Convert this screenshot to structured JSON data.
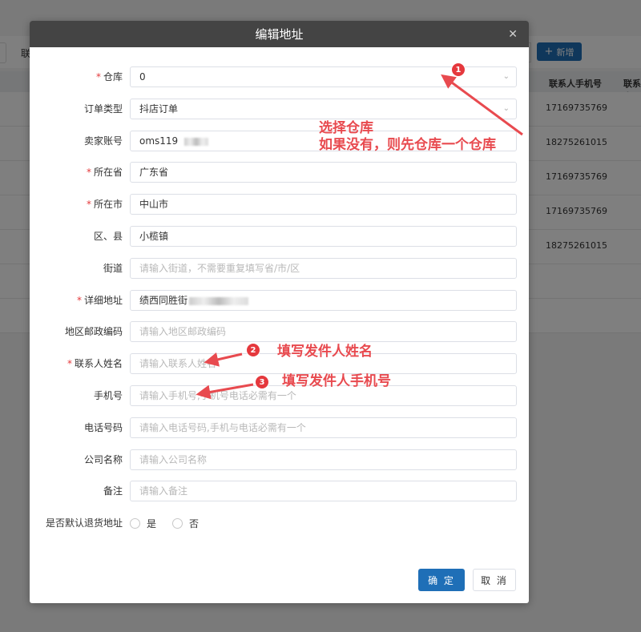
{
  "background": {
    "left_label": "联",
    "add_button": {
      "icon": "plus-icon",
      "label": "新增"
    },
    "table_headers": [
      "联系人手机号",
      "联系人"
    ],
    "rows": [
      "17169735769",
      "18275261015",
      "17169735769",
      "17169735769",
      "18275261015"
    ]
  },
  "modal": {
    "title": "编辑地址",
    "close_icon": "close-icon",
    "fields": [
      {
        "label": "仓库",
        "required": true,
        "value": "0",
        "placeholder": "",
        "type": "select"
      },
      {
        "label": "订单类型",
        "required": false,
        "value": "抖店订单",
        "placeholder": "",
        "type": "select"
      },
      {
        "label": "卖家账号",
        "required": false,
        "value": "oms119",
        "placeholder": "",
        "type": "text"
      },
      {
        "label": "所在省",
        "required": true,
        "value": "广东省",
        "placeholder": "",
        "type": "text"
      },
      {
        "label": "所在市",
        "required": true,
        "value": "中山市",
        "placeholder": "",
        "type": "text"
      },
      {
        "label": "区、县",
        "required": false,
        "value": "小榄镇",
        "placeholder": "",
        "type": "text"
      },
      {
        "label": "街道",
        "required": false,
        "value": "",
        "placeholder": "请输入街道，不需要重复填写省/市/区",
        "type": "text"
      },
      {
        "label": "详细地址",
        "required": true,
        "value": "绩西同胜街",
        "placeholder": "",
        "type": "text"
      },
      {
        "label": "地区邮政编码",
        "required": false,
        "value": "",
        "placeholder": "请输入地区邮政编码",
        "type": "text"
      },
      {
        "label": "联系人姓名",
        "required": true,
        "value": "",
        "placeholder": "请输入联系人姓名",
        "type": "text"
      },
      {
        "label": "手机号",
        "required": false,
        "value": "",
        "placeholder": "请输入手机号,手机号电话必需有一个",
        "type": "text"
      },
      {
        "label": "电话号码",
        "required": false,
        "value": "",
        "placeholder": "请输入电话号码,手机与电话必需有一个",
        "type": "text"
      },
      {
        "label": "公司名称",
        "required": false,
        "value": "",
        "placeholder": "请输入公司名称",
        "type": "text"
      },
      {
        "label": "备注",
        "required": false,
        "value": "",
        "placeholder": "请输入备注",
        "type": "text"
      }
    ],
    "default_return": {
      "label": "是否默认退货地址",
      "options": [
        "是",
        "否"
      ]
    },
    "ok_label": "确 定",
    "cancel_label": "取 消"
  },
  "annotations": {
    "a1_num": "1",
    "a1_line1": "选择仓库",
    "a1_line2": "如果没有，则先仓库一个仓库",
    "a2_num": "2",
    "a2_text": "填写发件人姓名",
    "a3_num": "3",
    "a3_text": "填写发件人手机号",
    "color": "#e84a4f"
  }
}
